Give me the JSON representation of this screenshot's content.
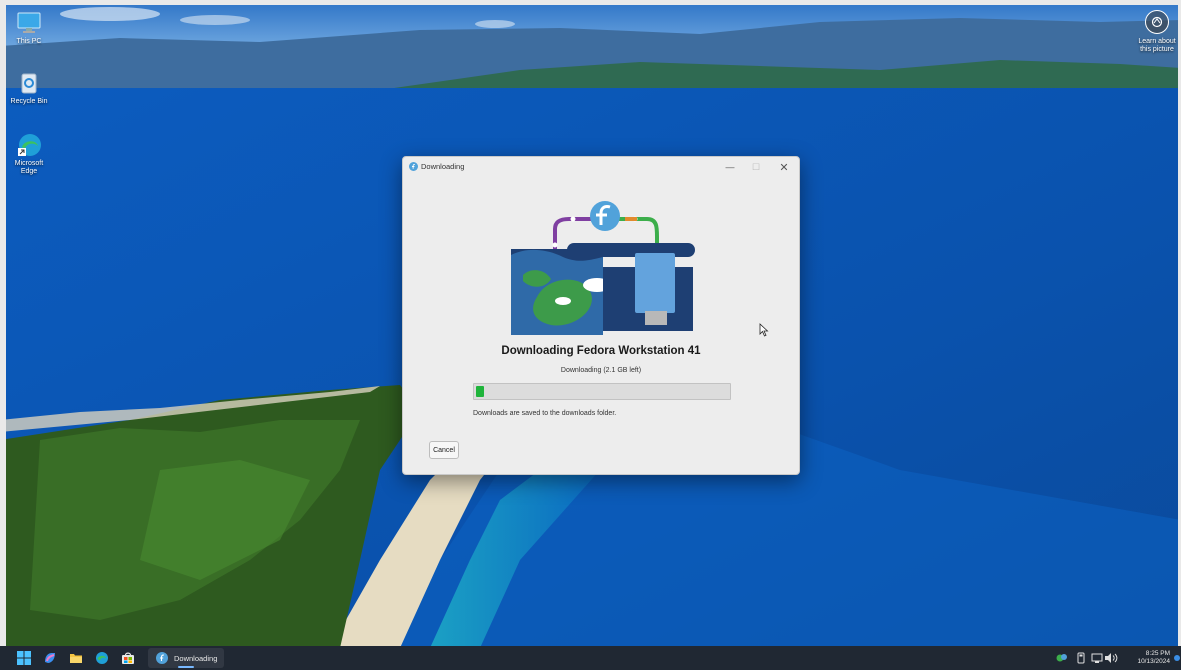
{
  "desktop": {
    "icons": [
      {
        "label": "This PC",
        "icon": "computer-icon"
      },
      {
        "label": "Recycle Bin",
        "icon": "recycle-bin-icon"
      },
      {
        "label": "Microsoft Edge",
        "icon": "edge-icon"
      }
    ],
    "learn_about": "Learn about this picture"
  },
  "dialog": {
    "title": "Downloading",
    "heading": "Downloading Fedora Workstation 41",
    "status": "Downloading (2.1 GB left)",
    "progress_fraction": 0.03,
    "note": "Downloads are saved to the downloads folder.",
    "cancel_label": "Cancel"
  },
  "taskbar": {
    "pinned": [
      "start-icon",
      "copilot-icon",
      "file-explorer-icon",
      "edge-icon",
      "store-icon"
    ],
    "active_window_label": "Downloading",
    "clock_time": "8:25 PM",
    "clock_date": "10/13/2024"
  },
  "colors": {
    "progress_fill": "#1fb43b",
    "fedora_blue": "#51a2da",
    "taskbar_bg": "#202833"
  }
}
